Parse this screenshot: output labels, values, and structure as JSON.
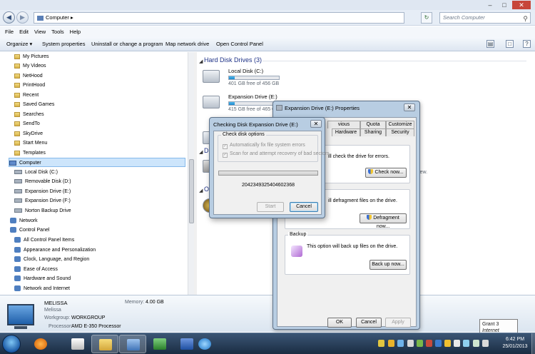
{
  "window": {
    "title_controls": [
      "–",
      "□",
      "✕"
    ]
  },
  "address": {
    "path": "Computer ▸",
    "search_placeholder": "Search Computer"
  },
  "menu": [
    "File",
    "Edit",
    "View",
    "Tools",
    "Help"
  ],
  "commands": {
    "organize": "Organize ▾",
    "system_properties": "System properties",
    "uninstall": "Uninstall or change a program",
    "map_drive": "Map network drive",
    "control_panel": "Open Control Panel"
  },
  "sidebar": {
    "items": [
      {
        "label": "My Pictures",
        "icon": "folder-icon"
      },
      {
        "label": "My Videos",
        "icon": "folder-icon"
      },
      {
        "label": "NetHood",
        "icon": "folder-icon"
      },
      {
        "label": "PrintHood",
        "icon": "folder-icon"
      },
      {
        "label": "Recent",
        "icon": "folder-icon"
      },
      {
        "label": "Saved Games",
        "icon": "folder-icon"
      },
      {
        "label": "Searches",
        "icon": "folder-icon"
      },
      {
        "label": "SendTo",
        "icon": "folder-icon"
      },
      {
        "label": "SkyDrive",
        "icon": "folder-icon"
      },
      {
        "label": "Start Menu",
        "icon": "folder-icon"
      },
      {
        "label": "Templates",
        "icon": "folder-icon"
      },
      {
        "label": "Computer",
        "icon": "computer-icon"
      },
      {
        "label": "Local Disk (C:)",
        "icon": "drive-icon"
      },
      {
        "label": "Removable Disk (D:)",
        "icon": "drive-icon"
      },
      {
        "label": "Expansion Drive (E:)",
        "icon": "drive-icon"
      },
      {
        "label": "Expansion Drive (F:)",
        "icon": "drive-icon"
      },
      {
        "label": "Norton Backup Drive",
        "icon": "drive-icon"
      },
      {
        "label": "Network",
        "icon": "network-icon"
      },
      {
        "label": "Control Panel",
        "icon": "control-panel-icon"
      },
      {
        "label": "All Control Panel Items",
        "icon": "control-panel-icon"
      },
      {
        "label": "Appearance and Personalization",
        "icon": "control-panel-icon"
      },
      {
        "label": "Clock, Language, and Region",
        "icon": "control-panel-icon"
      },
      {
        "label": "Ease of Access",
        "icon": "control-panel-icon"
      },
      {
        "label": "Hardware and Sound",
        "icon": "control-panel-icon"
      },
      {
        "label": "Network and Internet",
        "icon": "control-panel-icon"
      }
    ]
  },
  "content": {
    "hdd_header": "Hard Disk Drives (3)",
    "devices_header_partial": "D",
    "other_header_partial": "Ot",
    "drives": [
      {
        "name": "Local Disk (C:)",
        "free": "401 GB free of 456 GB",
        "used_fraction": 0.12
      },
      {
        "name": "Expansion Drive (E:)",
        "free": "415 GB free of 465 GB",
        "used_fraction": 0.11
      }
    ],
    "hint_partial": "iew."
  },
  "details": {
    "name": "MELISSA",
    "user": "Melissa",
    "workgroup_label": "Workgroup:",
    "workgroup": "WORKGROUP",
    "processor_label": "Processor:",
    "processor": "AMD E-350 Processor",
    "memory_label": "Memory:",
    "memory": "4.00 GB"
  },
  "properties_dialog": {
    "title": "Expansion Drive (E:) Properties",
    "tabs_row1": [
      "vious Versions",
      "Quota",
      "Customize"
    ],
    "tabs_row2": [
      "Hardware",
      "Sharing",
      "Security"
    ],
    "error_text": "ill check the drive for errors.",
    "check_btn": "Check now...",
    "defrag_text": "ill defragment files on the drive.",
    "defrag_btn": "Defragment now...",
    "backup_title": "Backup",
    "backup_text": "This option will back up files on the drive.",
    "backup_btn": "Back up now...",
    "ok": "OK",
    "cancel": "Cancel",
    "apply": "Apply"
  },
  "check_dialog": {
    "title": "Checking Disk Expansion Drive (E:)",
    "options_title": "Check disk options",
    "opt1": "Automatically fix file system errors",
    "opt2": "Scan for and attempt recovery of bad sectors",
    "progress": 0.0,
    "status": "2042349325404602368",
    "start": "Start",
    "cancel": "Cancel"
  },
  "tooltip": {
    "line1": "Grant  3",
    "line2": "Internet access"
  },
  "clock": {
    "time": "6:42 PM",
    "date": "25/01/2013"
  }
}
